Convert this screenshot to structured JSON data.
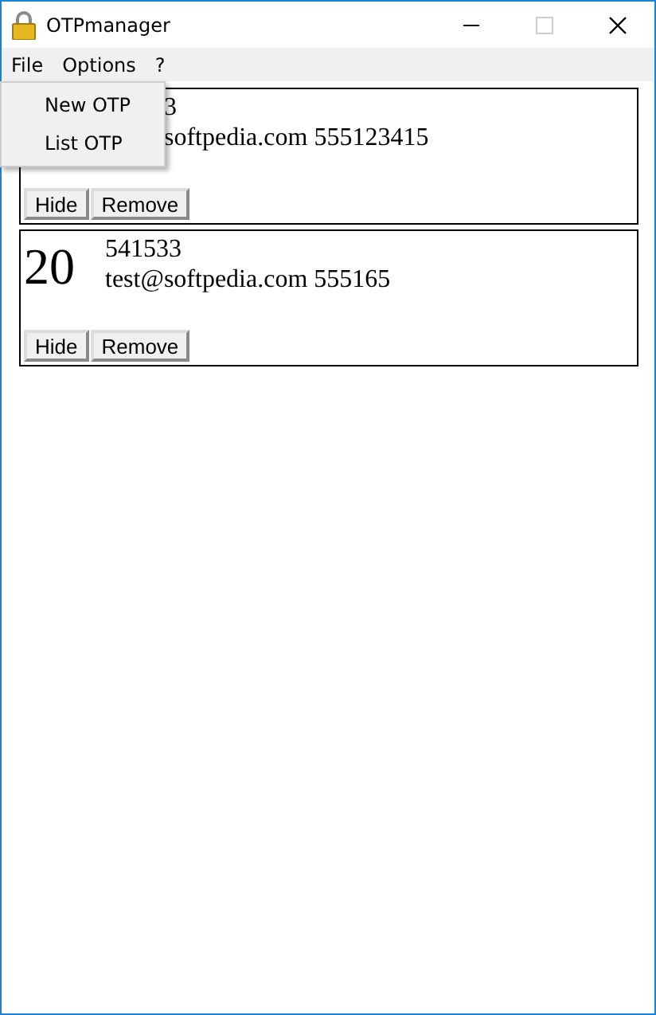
{
  "window": {
    "title": "OTPmanager"
  },
  "menu_bar": [
    "File",
    "Options",
    "?"
  ],
  "open_menu": {
    "items": [
      "New OTP",
      "List OTP"
    ]
  },
  "entries": [
    {
      "code": "3",
      "account": "softpedia.com 555123415",
      "buttons": [
        "Hide",
        "Remove"
      ]
    },
    {
      "counter": "20",
      "code": "541533",
      "account": "test@softpedia.com 555165",
      "buttons": [
        "Hide",
        "Remove"
      ]
    }
  ]
}
